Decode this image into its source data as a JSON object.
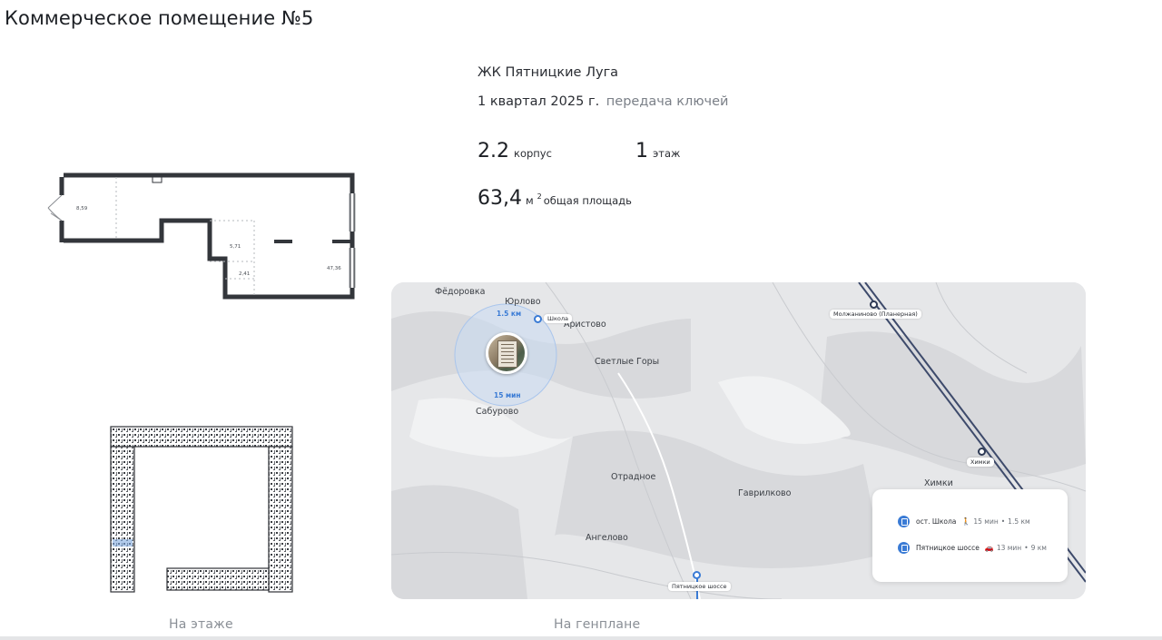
{
  "header": {
    "title": "Коммерческое помещение №5"
  },
  "info": {
    "complex": "ЖК Пятницкие Луга",
    "handover_date": "1 квартал 2025 г.",
    "handover_label": "передача ключей",
    "building_value": "2.2",
    "building_label": "корпус",
    "floor_value": "1",
    "floor_label": "этаж",
    "area_value": "63,4",
    "area_unit": "м",
    "area_unit_sup": "2",
    "area_label": "общая площадь"
  },
  "plan": {
    "room_areas": [
      "8,59",
      "5,71",
      "2,41",
      "47,36"
    ]
  },
  "captions": {
    "on_floor": "На этаже",
    "on_site": "На генплане"
  },
  "map": {
    "radius_label": "1.5 км",
    "time_label": "15 мин",
    "places": [
      "Фёдоровка",
      "Юрлово",
      "Аристово",
      "Светлые Горы",
      "Сабурово",
      "Отрадное",
      "Гаврилково",
      "Ангелово",
      "Химки"
    ],
    "stops": {
      "school": "Школа",
      "metro": "Молжаниново (Планерная)",
      "khimki_station": "Химки",
      "highway_stop": "Пятницкое шоссе"
    },
    "transport": [
      {
        "name": "ост. Школа",
        "mode_icon": "walk-icon",
        "time": "15 мин",
        "distance": "1.5 км"
      },
      {
        "name": "Пятницкое шоссе",
        "mode_icon": "car-icon",
        "time": "13 мин",
        "distance": "9 км"
      }
    ],
    "colors": {
      "accent": "#3a7bd5",
      "rail": "#2e3a55",
      "map_bg": "#e7e8ea"
    }
  }
}
